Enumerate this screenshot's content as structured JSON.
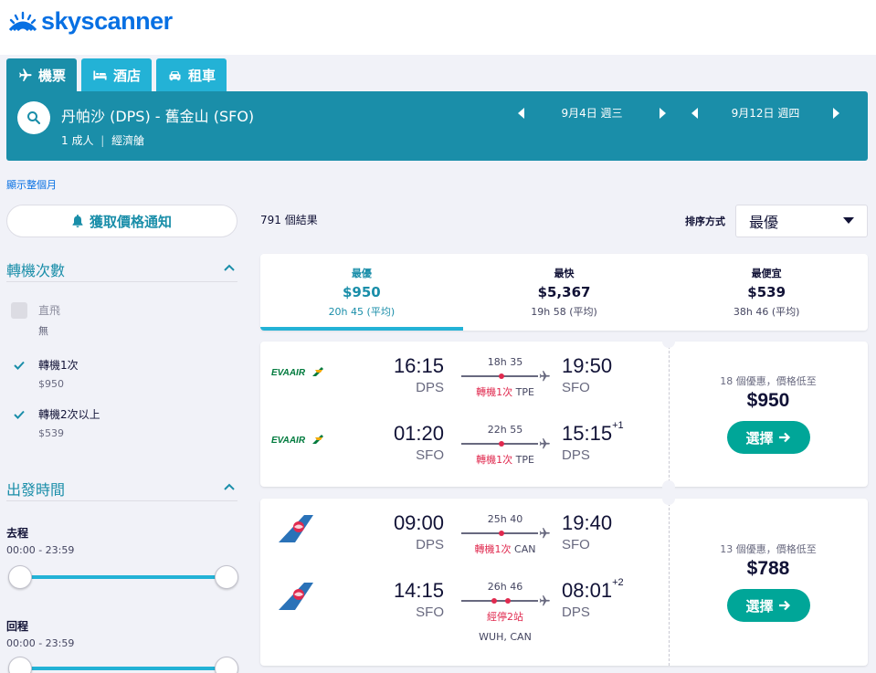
{
  "brand": {
    "name": "skyscanner",
    "color": "#0770e3"
  },
  "tabs": [
    {
      "label": "機票",
      "icon": "plane-icon",
      "active": true
    },
    {
      "label": "酒店",
      "icon": "bed-icon",
      "active": false
    },
    {
      "label": "租車",
      "icon": "car-icon",
      "active": false
    }
  ],
  "search": {
    "route": "丹帕沙 (DPS) - 舊金山 (SFO)",
    "passengers": "1 成人",
    "cabin": "經濟艙",
    "outbound_date": "9月4日 週三",
    "return_date": "9月12日 週四"
  },
  "sidebar": {
    "month_link": "顯示整個月",
    "price_alert": "獲取價格通知",
    "stops": {
      "title": "轉機次數",
      "options": [
        {
          "label": "直飛",
          "price": "無",
          "checked": false,
          "disabled": true
        },
        {
          "label": "轉機1次",
          "price": "$950",
          "checked": true,
          "disabled": false
        },
        {
          "label": "轉機2次以上",
          "price": "$539",
          "checked": true,
          "disabled": false
        }
      ]
    },
    "departure": {
      "title": "出發時間",
      "outbound_label": "去程",
      "outbound_range": "00:00 - 23:59",
      "return_label": "回程",
      "return_range": "00:00 - 23:59"
    }
  },
  "results": {
    "count": "791 個結果",
    "sort_label": "排序方式",
    "sort_value": "最優",
    "sort_tabs": [
      {
        "title": "最優",
        "price": "$950",
        "duration": "20h 45 (平均)",
        "active": true
      },
      {
        "title": "最快",
        "price": "$5,367",
        "duration": "19h 58 (平均)",
        "active": false
      },
      {
        "title": "最便宜",
        "price": "$539",
        "duration": "38h 46 (平均)",
        "active": false
      }
    ]
  },
  "cards": [
    {
      "deals": "18 個優惠，價格低至",
      "price": "$950",
      "select_label": "選擇",
      "legs": [
        {
          "airline": "EVA AIR",
          "dep_time": "16:15",
          "dep_code": "DPS",
          "duration": "18h 35",
          "stops_text": "轉機1次",
          "via": "TPE",
          "arr_time": "19:50",
          "arr_day": "",
          "arr_code": "SFO"
        },
        {
          "airline": "EVA AIR",
          "dep_time": "01:20",
          "dep_code": "SFO",
          "duration": "22h 55",
          "stops_text": "轉機1次",
          "via": "TPE",
          "arr_time": "15:15",
          "arr_day": "+1",
          "arr_code": "DPS"
        }
      ]
    },
    {
      "deals": "13 個優惠，價格低至",
      "price": "$788",
      "select_label": "選擇",
      "legs": [
        {
          "airline": "China Southern",
          "dep_time": "09:00",
          "dep_code": "DPS",
          "duration": "25h 40",
          "stops_text": "轉機1次",
          "via": "CAN",
          "arr_time": "19:40",
          "arr_day": "",
          "arr_code": "SFO"
        },
        {
          "airline": "China Southern",
          "dep_time": "14:15",
          "dep_code": "SFO",
          "duration": "26h 46",
          "stops_text": "經停2站",
          "via_below": "WUH, CAN",
          "arr_time": "08:01",
          "arr_day": "+2",
          "arr_code": "DPS"
        }
      ]
    }
  ],
  "colors": {
    "header": "#1a8ea9",
    "accent": "#23b2d6",
    "select": "#00a698",
    "stop": "#e02a4f"
  }
}
